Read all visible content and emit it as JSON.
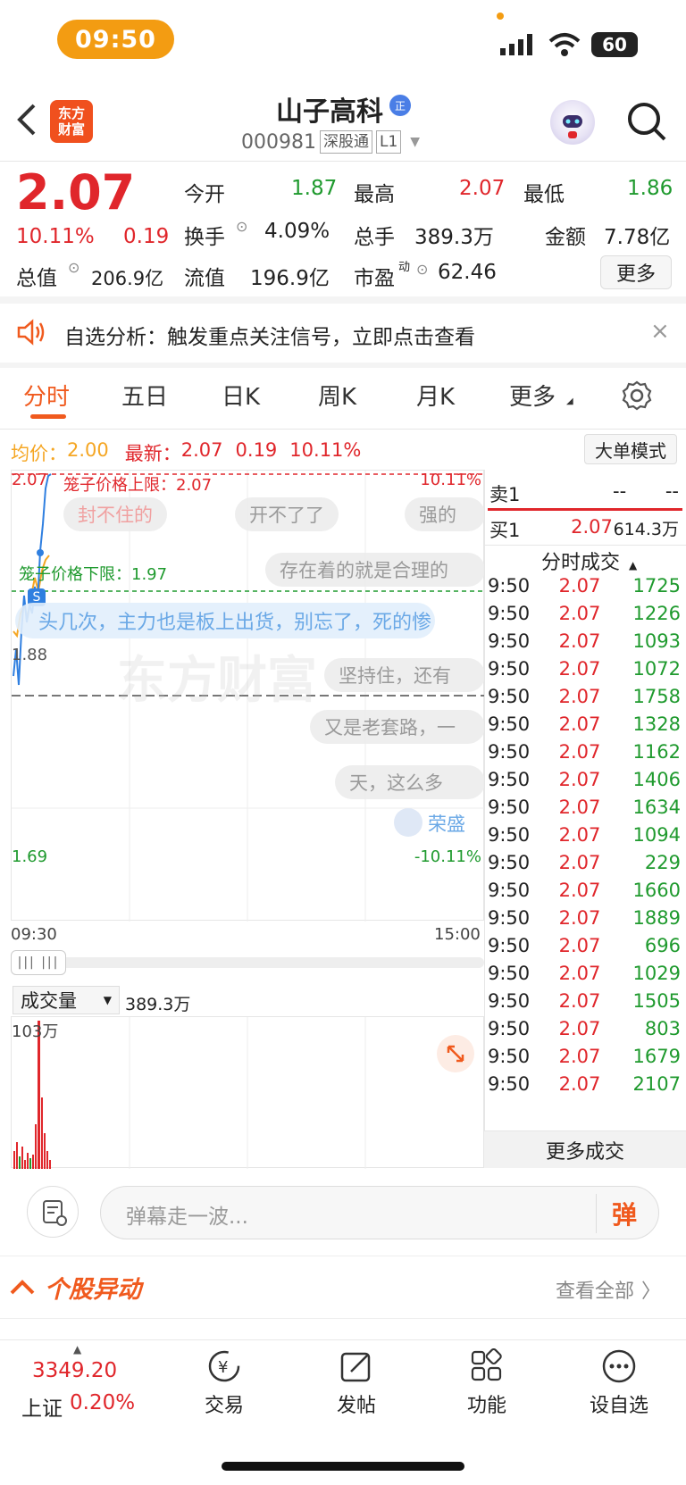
{
  "status_bar": {
    "time": "09:50",
    "battery": "60"
  },
  "header": {
    "logo_line1": "东方",
    "logo_line2": "财富",
    "stock_name": "山子高科",
    "badge": "正",
    "code": "000981",
    "tag1": "深股通",
    "tag2": "L1"
  },
  "quote": {
    "price": "2.07",
    "change_pct": "10.11%",
    "change": "0.19",
    "open_label": "今开",
    "open": "1.87",
    "high_label": "最高",
    "high": "2.07",
    "low_label": "最低",
    "low": "1.86",
    "turnover_label": "换手",
    "turnover": "4.09%",
    "volume_label": "总手",
    "volume": "389.3万",
    "amount_label": "金额",
    "amount": "7.78亿",
    "mcap_label": "总值",
    "mcap": "206.9亿",
    "float_label": "流值",
    "float": "196.9亿",
    "pe_label": "市盈",
    "pe_sup": "动",
    "pe": "62.46",
    "more_button": "更多"
  },
  "notice": {
    "text": "自选分析：触发重点关注信号，立即点击查看"
  },
  "tabs": [
    {
      "label": "分时"
    },
    {
      "label": "五日"
    },
    {
      "label": "日K"
    },
    {
      "label": "周K"
    },
    {
      "label": "月K"
    },
    {
      "label": "更多"
    }
  ],
  "chart_info": {
    "avg_label": "均价：",
    "avg": "2.00",
    "latest_label": "最新：",
    "latest": "2.07",
    "latest_chg": "0.19",
    "latest_pct": "10.11%",
    "mode_button": "大单模式",
    "y_top": "2.07",
    "y_top_pct": "10.11%",
    "y_mid": "1.88",
    "y_bottom": "1.69",
    "y_bottom_pct": "-10.11%",
    "x_start": "09:30",
    "x_end": "15:00",
    "cage_upper": "笼子价格上限：2.07",
    "cage_lower": "笼子价格下限：1.97",
    "watermark": "东方财富",
    "s_badge": "S"
  },
  "danmu": [
    "封不住的",
    "开不了了",
    "强的",
    "存在着的就是合理的",
    "头几次，主力也是板上出货，别忘了，死的惨",
    "坚持住，还有",
    "又是老套路，一",
    "天，这么多",
    "荣盛"
  ],
  "volume": {
    "selector": "成交量",
    "value": "389.3万",
    "y_max": "103万"
  },
  "order_book": {
    "sell1_label": "卖1",
    "sell1_price": "--",
    "sell1_vol": "--",
    "buy1_label": "买1",
    "buy1_price": "2.07",
    "buy1_vol": "614.3万"
  },
  "trades_header": "分时成交",
  "trades": [
    {
      "time": "9:50",
      "price": "2.07",
      "vol": "1725"
    },
    {
      "time": "9:50",
      "price": "2.07",
      "vol": "1226"
    },
    {
      "time": "9:50",
      "price": "2.07",
      "vol": "1093"
    },
    {
      "time": "9:50",
      "price": "2.07",
      "vol": "1072"
    },
    {
      "time": "9:50",
      "price": "2.07",
      "vol": "1758"
    },
    {
      "time": "9:50",
      "price": "2.07",
      "vol": "1328"
    },
    {
      "time": "9:50",
      "price": "2.07",
      "vol": "1162"
    },
    {
      "time": "9:50",
      "price": "2.07",
      "vol": "1406"
    },
    {
      "time": "9:50",
      "price": "2.07",
      "vol": "1634"
    },
    {
      "time": "9:50",
      "price": "2.07",
      "vol": "1094"
    },
    {
      "time": "9:50",
      "price": "2.07",
      "vol": "229"
    },
    {
      "time": "9:50",
      "price": "2.07",
      "vol": "1660"
    },
    {
      "time": "9:50",
      "price": "2.07",
      "vol": "1889"
    },
    {
      "time": "9:50",
      "price": "2.07",
      "vol": "696"
    },
    {
      "time": "9:50",
      "price": "2.07",
      "vol": "1029"
    },
    {
      "time": "9:50",
      "price": "2.07",
      "vol": "1505"
    },
    {
      "time": "9:50",
      "price": "2.07",
      "vol": "803"
    },
    {
      "time": "9:50",
      "price": "2.07",
      "vol": "1679"
    },
    {
      "time": "9:50",
      "price": "2.07",
      "vol": "2107"
    }
  ],
  "more_trades": "更多成交",
  "danmu_input": {
    "placeholder": "弹幕走一波...",
    "send": "弹"
  },
  "anomaly": {
    "title": "个股异动",
    "view_all": "查看全部"
  },
  "bottom_nav": {
    "index_value": "3349.20",
    "index_name": "上证",
    "index_pct": "0.20%",
    "trade": "交易",
    "post": "发帖",
    "function": "功能",
    "watchlist": "设自选"
  },
  "colors": {
    "up": "#e0262b",
    "down": "#1f9a2e",
    "accent": "#f05a1e",
    "avg_line": "#f5a623",
    "price_line": "#2f7fe0"
  }
}
